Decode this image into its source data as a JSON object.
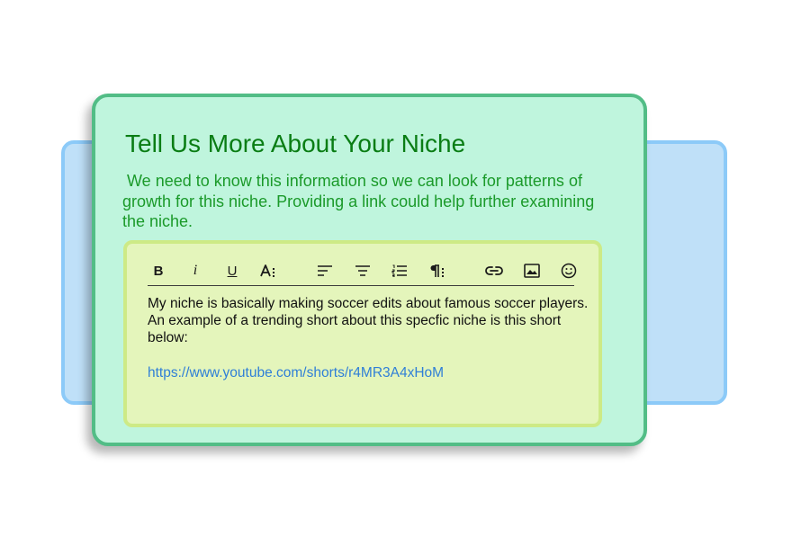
{
  "form": {
    "title": "Tell Us More About Your Niche",
    "description": " We need to know this information so we can look for patterns of growth for this niche. Providing a link could help further examining the niche."
  },
  "editor": {
    "toolbar": {
      "bold_label": "B",
      "italic_label": "i",
      "underline_label": "U",
      "icons": [
        "text-size-icon",
        "align-left-icon",
        "align-center-icon",
        "numbered-list-icon",
        "paragraph-icon",
        "link-icon",
        "image-icon",
        "emoji-icon"
      ]
    },
    "body_text": "My niche is basically making soccer edits about famous soccer players. An example of a trending short about this specfic niche is this short below:",
    "link_text": "https://www.youtube.com/shorts/r4MR3A4xHoM"
  },
  "colors": {
    "back_card_fill": "#bfe0f8",
    "back_card_border": "#8ccaf8",
    "front_card_fill": "#bff5dd",
    "front_card_border": "#52bd86",
    "editor_fill": "#e4f5bb",
    "editor_border": "#cdea86",
    "title_color": "#0a7d14",
    "description_color": "#1b9a2a",
    "link_color": "#2f7fd7"
  }
}
